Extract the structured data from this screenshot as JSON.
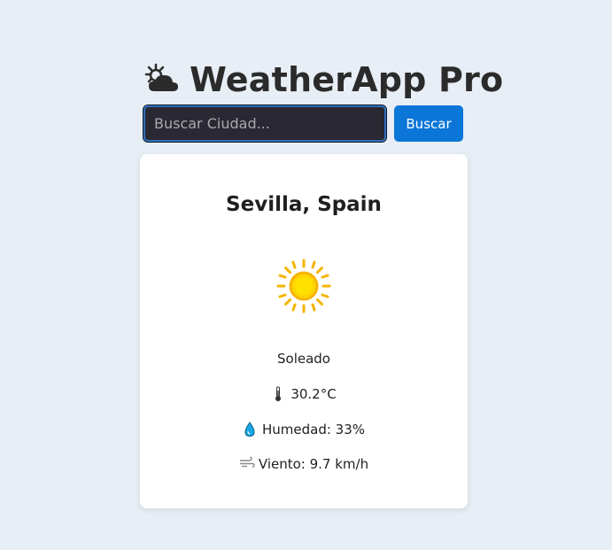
{
  "header": {
    "title": "WeatherApp Pro",
    "icon": "sun-behind-cloud-icon"
  },
  "search": {
    "placeholder": "Buscar Ciudad...",
    "value": "",
    "button_label": "Buscar"
  },
  "weather": {
    "city": "Sevilla, Spain",
    "condition_icon": "sun-icon",
    "condition": "Soleado",
    "temperature": "30.2°C",
    "humidity": "Humedad: 33%",
    "wind": "Viento: 9.7 km/h"
  },
  "colors": {
    "background": "#e8eef5",
    "button": "#0b76d8",
    "card": "#ffffff",
    "sun": "#ffd500"
  }
}
